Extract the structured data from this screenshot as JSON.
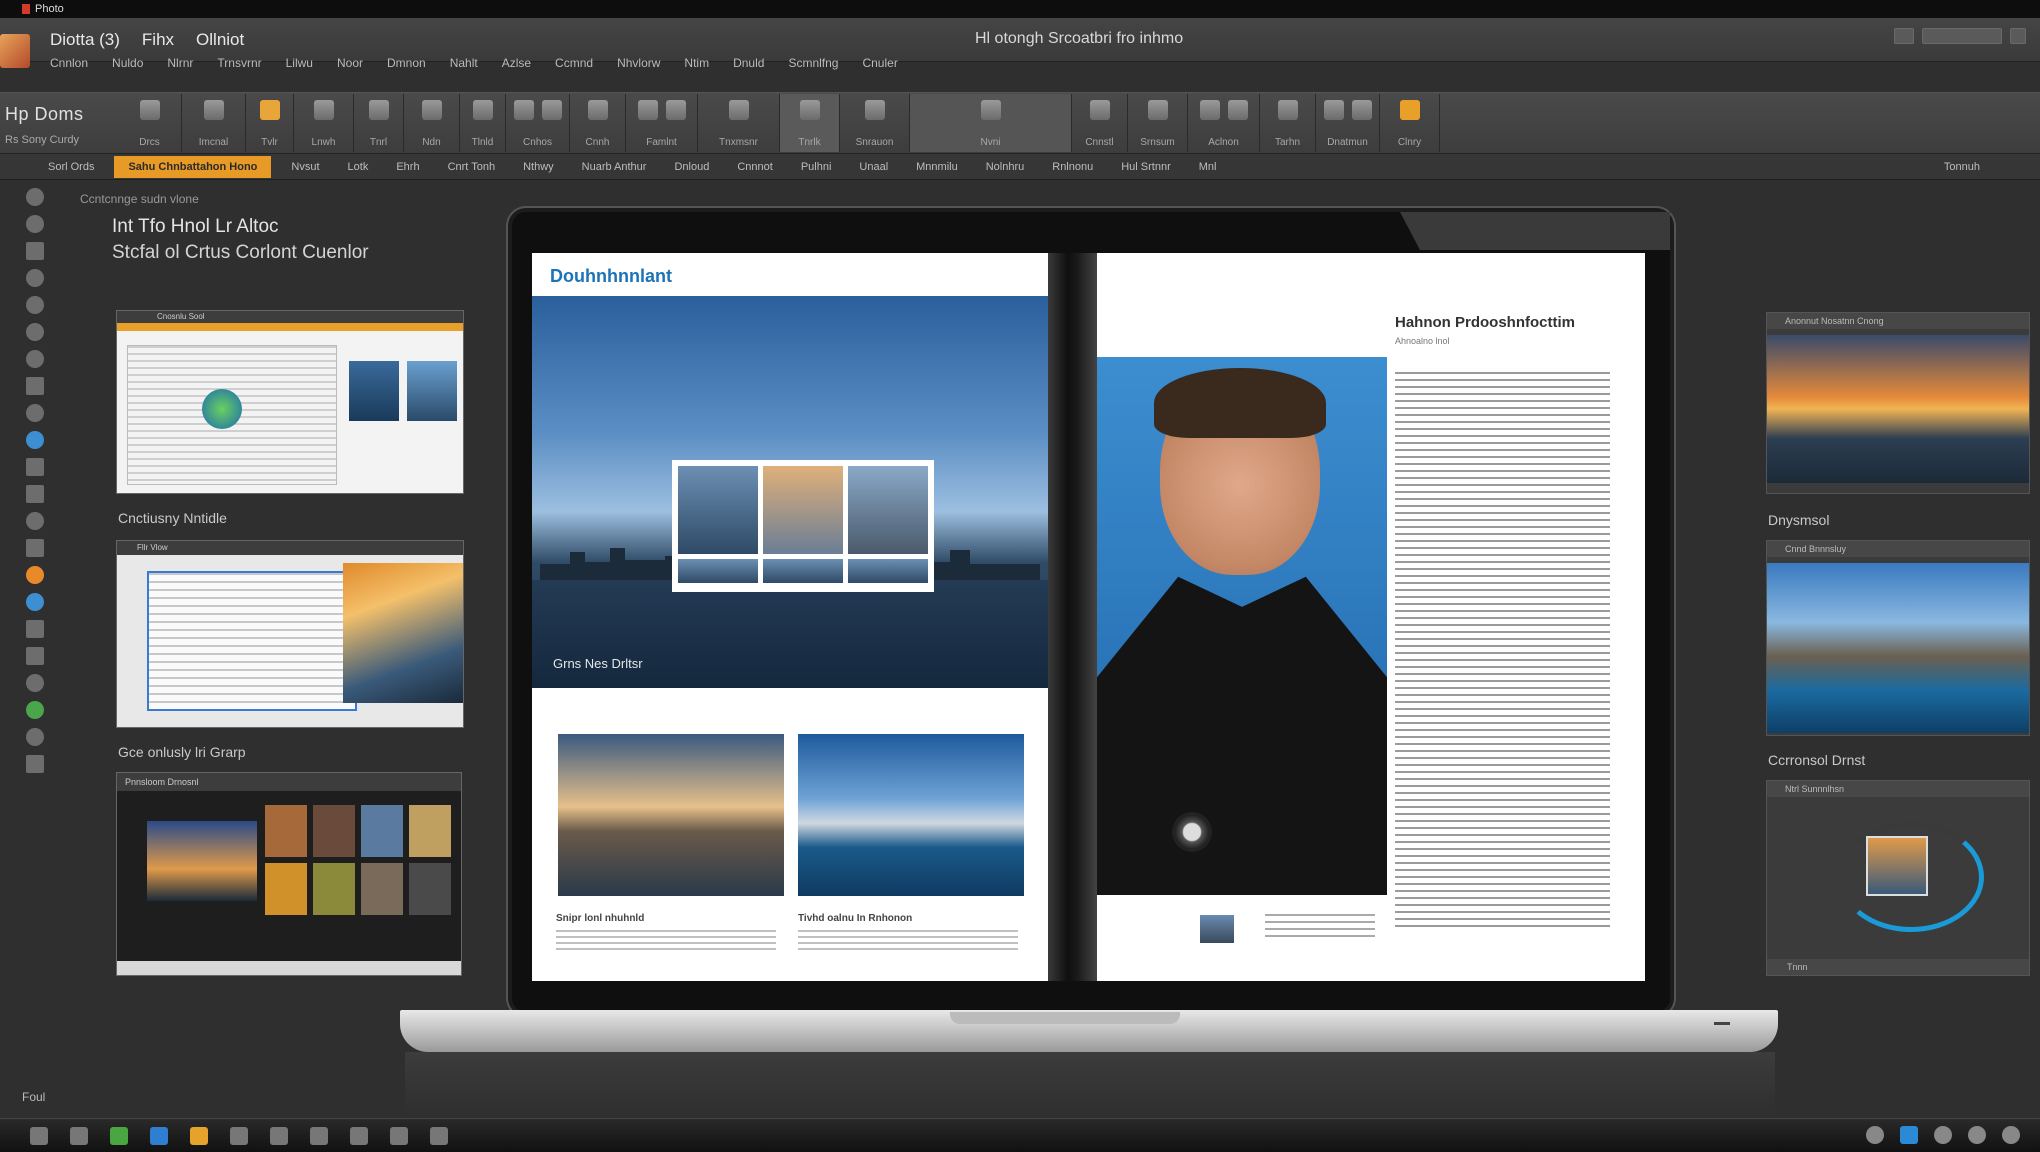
{
  "system_bar": {
    "app_label": "Photo"
  },
  "title_bar": {
    "menu_top": [
      "Diotta (3)",
      "Fihx",
      "Ollniot"
    ],
    "menu_sub": [
      "Cnnlon",
      "Nuldo",
      "Nlrnr",
      "Trnsvrnr",
      "Lilwu",
      "Noor",
      "Dmnon",
      "Nahlt",
      "Azlse",
      "Ccmnd",
      "Nhvlorw",
      "Ntim",
      "Dnuld",
      "Scmnlfng",
      "Cnuler"
    ],
    "document_title": "Hl otongh Srcoatbri fro inhmo"
  },
  "ribbon": {
    "title": "Hp Doms",
    "subtitle": "Rs Sony Curdy",
    "groups": [
      {
        "label": "Drcs"
      },
      {
        "label": "Imcnal"
      },
      {
        "label": "Tvlr"
      },
      {
        "label": "Lnwh"
      },
      {
        "label": "Tnrl"
      },
      {
        "label": "Ndn"
      },
      {
        "label": "Tlnld"
      },
      {
        "label": "Cnhos"
      },
      {
        "label": "Cnnh"
      },
      {
        "label": "Famlnt"
      },
      {
        "label": "Tnxmsnr"
      },
      {
        "label": "Tnrlk"
      },
      {
        "label": "Snrauon"
      },
      {
        "label": "Nvni"
      },
      {
        "label": "Cnnstl"
      },
      {
        "label": "Srnsum"
      },
      {
        "label": "Aclnon"
      },
      {
        "label": "Tarhn"
      },
      {
        "label": "Dnatmun"
      },
      {
        "label": "Clnry"
      }
    ]
  },
  "toolbar2": {
    "items_before": [
      "Sorl Ords"
    ],
    "highlight": "Sahu Chnbattahon Hono",
    "items_after": [
      "Nvsut",
      "Lotk",
      "Ehrh",
      "Cnrt Tonh",
      "Nthwy",
      "Nuarb Anthur",
      "Dnloud",
      "Cnnnot",
      "Pulhni",
      "Unaal",
      "Mnnmilu",
      "Nolnhru",
      "Rnlnonu",
      "Hul Srtnnr",
      "Mnl"
    ],
    "right_label": "Tonnuh"
  },
  "left_footer": "Foul",
  "workspace": {
    "breadcrumb": "Ccntcnnge sudn vlone",
    "heading_line1": "Int Tfo Hnol Lr Altoc",
    "heading_line2": "Stcfal ol Crtus Corlont Cuenlor"
  },
  "left_thumbs": [
    {
      "caption": "Cnctiusny Nntidle",
      "title": "Cnosnlu Sool"
    },
    {
      "caption": "Gce onlusly lri Grarp",
      "title": "Fllr Vlow"
    },
    {
      "caption": "",
      "title": "Pnnsloom Drnosnl"
    }
  ],
  "magazine": {
    "brand": "Douhnhnnlant",
    "hero_caption": "Grns Nes Drltsr",
    "pic1_caption": "Snipr lonl nhuhnld",
    "pic2_caption": "Tivhd oalnu In Rnhonon",
    "article_title": "Hahnon Prdooshnfocttim",
    "article_sub": "Ahnoalno lnol"
  },
  "right_panels": [
    {
      "title": "Anonnut Nosatnn Cnong",
      "caption": "Dnysmsol"
    },
    {
      "title": "Cnnd Bnnnsluy",
      "caption": "Ccrronsol Drnst"
    },
    {
      "title": "Ntrl Sunnnlhsn",
      "footer": "Tnnn"
    }
  ],
  "colors": {
    "accent_orange": "#e89a26",
    "brand_blue": "#1b73b8",
    "dial_blue": "#1a9ad6"
  }
}
